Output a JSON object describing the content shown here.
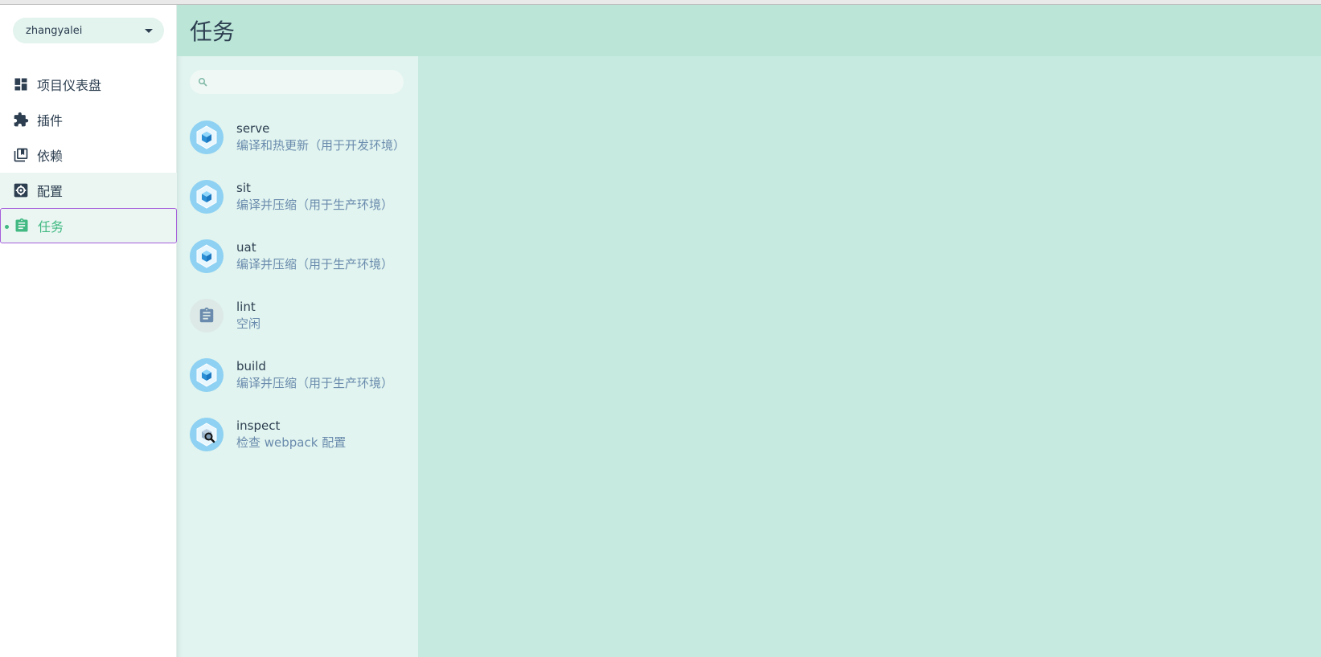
{
  "project": {
    "name": "zhangyalei"
  },
  "nav": {
    "items": [
      {
        "label": "项目仪表盘",
        "icon": "dashboard-icon"
      },
      {
        "label": "插件",
        "icon": "puzzle-icon"
      },
      {
        "label": "依赖",
        "icon": "library-books-icon"
      },
      {
        "label": "配置",
        "icon": "gear-icon"
      },
      {
        "label": "任务",
        "icon": "clipboard-icon"
      }
    ]
  },
  "header": {
    "title": "任务"
  },
  "search": {
    "placeholder": "",
    "value": ""
  },
  "tasks": [
    {
      "name": "serve",
      "description": "编译和热更新（用于开发环境）",
      "icon": "webpack-cube-icon"
    },
    {
      "name": "sit",
      "description": "编译并压缩（用于生产环境）",
      "icon": "webpack-cube-icon"
    },
    {
      "name": "uat",
      "description": "编译并压缩（用于生产环境）",
      "icon": "webpack-cube-icon"
    },
    {
      "name": "lint",
      "description": "空闲",
      "icon": "clipboard-icon"
    },
    {
      "name": "build",
      "description": "编译并压缩（用于生产环境）",
      "icon": "webpack-cube-icon"
    },
    {
      "name": "inspect",
      "description": "检查 webpack 配置",
      "icon": "webpack-inspect-icon"
    }
  ],
  "colors": {
    "accent": "#42b983",
    "text": "#2c3e50",
    "header_bg": "#bbe6d7",
    "pane_bg": "#e1f4ef",
    "detail_bg": "#c6eadf",
    "active_border": "#a55edb"
  }
}
